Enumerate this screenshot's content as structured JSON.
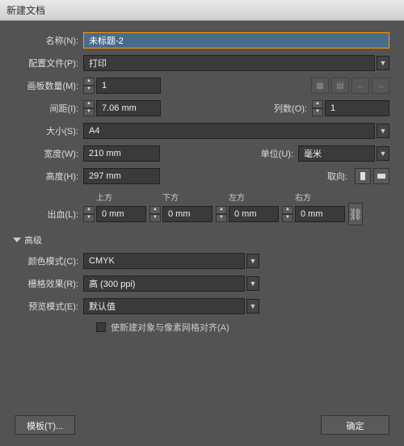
{
  "titlebar": "新建文档",
  "labels": {
    "name": "名称(N):",
    "profile": "配置文件(P):",
    "artboards": "画板数量(M):",
    "spacing": "间距(I):",
    "columns": "列数(O):",
    "size": "大小(S):",
    "width": "宽度(W):",
    "units": "单位(U):",
    "height": "高度(H):",
    "orient": "取向:",
    "bleed": "出血(L):",
    "advanced": "高级",
    "colormode": "颜色模式(C):",
    "raster": "栅格效果(R):",
    "preview": "预览模式(E):"
  },
  "values": {
    "name": "未标题-2",
    "profile": "打印",
    "artboards": "1",
    "spacing": "7.06 mm",
    "columns": "1",
    "size": "A4",
    "width": "210 mm",
    "units": "毫米",
    "height": "297 mm",
    "colormode": "CMYK",
    "raster": "高 (300 ppi)",
    "preview": "默认值"
  },
  "bleed": {
    "top_h": "上方",
    "bottom_h": "下方",
    "left_h": "左方",
    "right_h": "右方",
    "top": "0 mm",
    "bottom": "0 mm",
    "left": "0 mm",
    "right": "0 mm"
  },
  "checkbox": "使新建对象与像素网格对齐(A)",
  "buttons": {
    "templates": "模板(T)...",
    "ok": "确定"
  }
}
